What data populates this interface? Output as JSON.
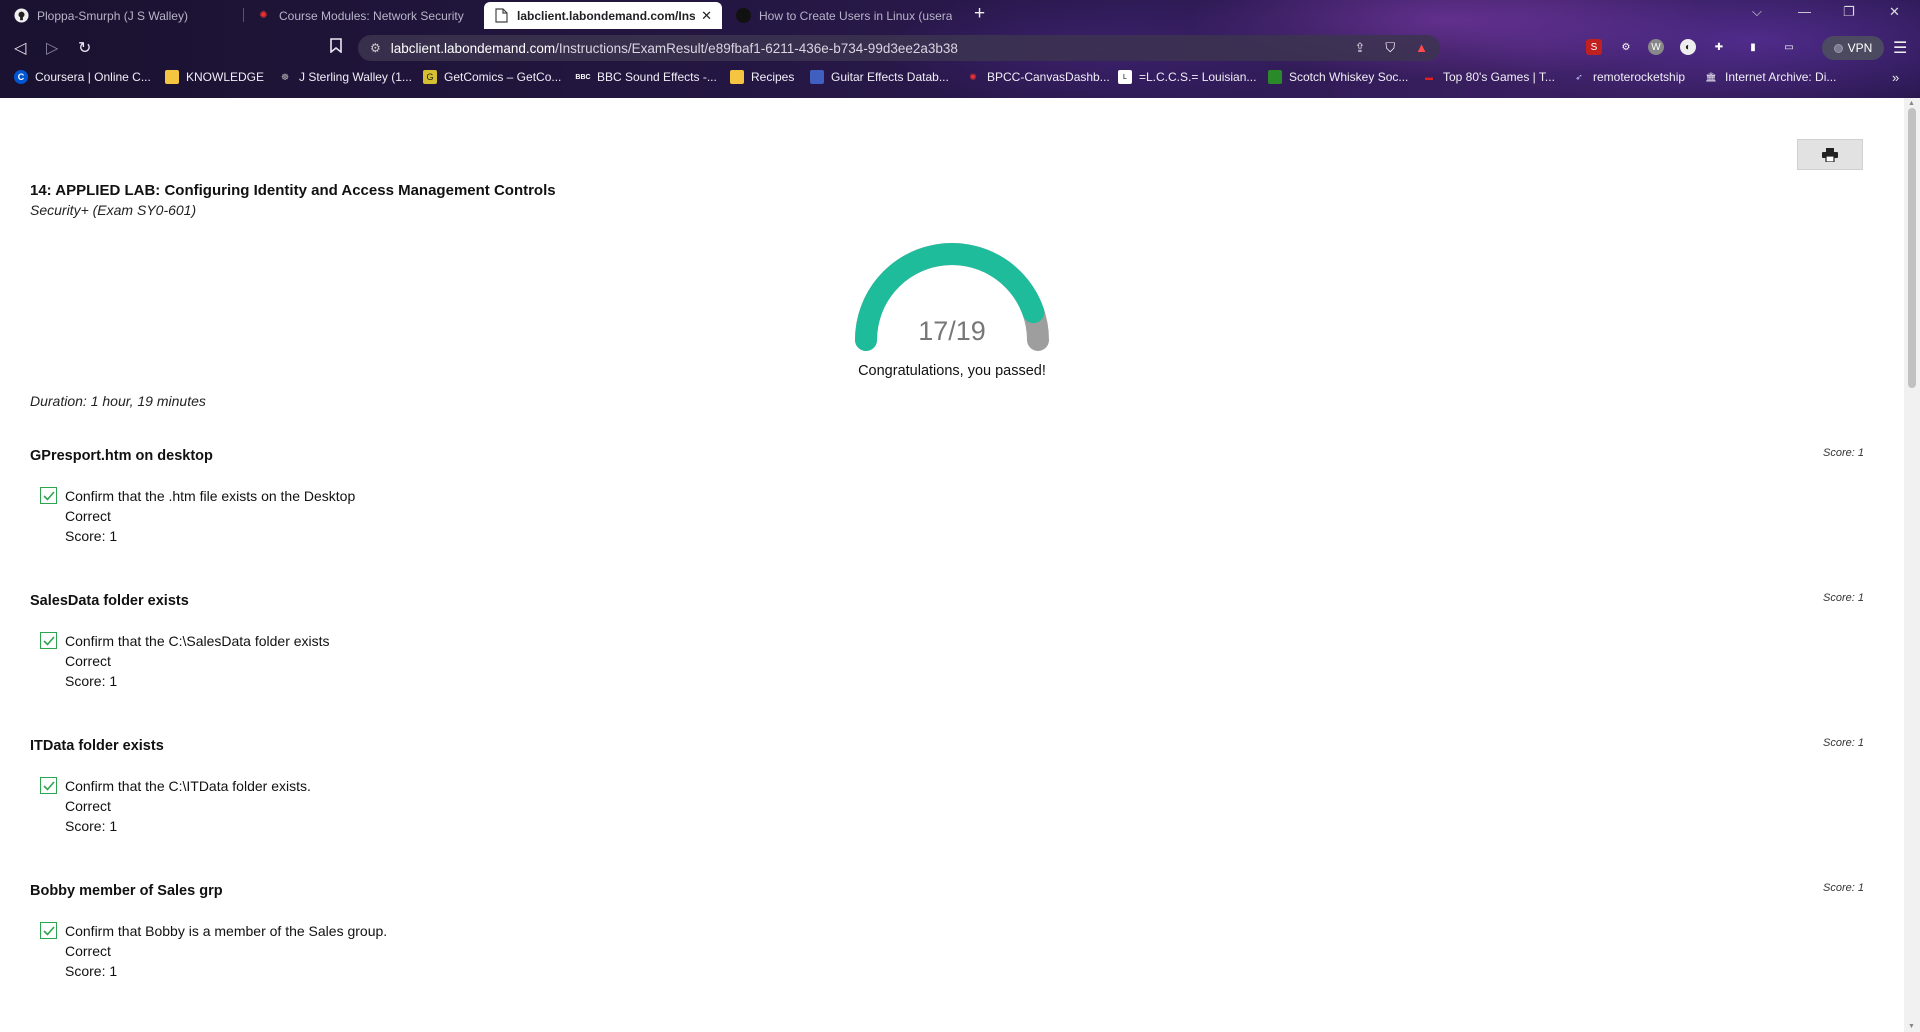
{
  "browser": {
    "tabs": [
      {
        "title": "Ploppa-Smurph (J S Walley)",
        "icon": "github-icon",
        "active": false
      },
      {
        "title": "Course Modules: Network Security De",
        "icon": "canvas-icon",
        "active": false
      },
      {
        "title": "labclient.labondemand.com/Inst",
        "icon": "document-icon",
        "active": true
      },
      {
        "title": "How to Create Users in Linux (useradd",
        "icon": "site-icon",
        "active": false
      }
    ],
    "url_host": "labclient.labondemand.com",
    "url_path": "/Instructions/ExamResult/e89fbaf1-6211-436e-b734-99d3ee2a3b38",
    "vpn_label": "VPN",
    "bookmarks": [
      {
        "label": "Coursera | Online C...",
        "icon": "coursera-icon",
        "color": "#0056d2"
      },
      {
        "label": "KNOWLEDGE",
        "icon": "folder-icon",
        "color": "#f5c542"
      },
      {
        "label": "J Sterling Walley (1...",
        "icon": "site-icon",
        "color": "#888888"
      },
      {
        "label": "GetComics – GetCo...",
        "icon": "getcomics-icon",
        "color": "#d4c030"
      },
      {
        "label": "BBC Sound Effects -...",
        "icon": "bbc-icon",
        "color": "#ffffff"
      },
      {
        "label": "Recipes",
        "icon": "folder-icon",
        "color": "#f5c542"
      },
      {
        "label": "Guitar Effects Datab...",
        "icon": "guitar-icon",
        "color": "#4060c0"
      },
      {
        "label": "BPCC-CanvasDashb...",
        "icon": "canvas-icon",
        "color": "#e03030"
      },
      {
        "label": "=L.C.C.S.= Louisian...",
        "icon": "site-icon",
        "color": "#ffffff"
      },
      {
        "label": "Scotch Whiskey Soc...",
        "icon": "whiskey-icon",
        "color": "#2a8a2a"
      },
      {
        "label": "Top 80's Games | T...",
        "icon": "games-icon",
        "color": "#e02020"
      },
      {
        "label": "remoterocketship",
        "icon": "rocket-icon",
        "color": "#c0c0ff"
      },
      {
        "label": "Internet Archive: Di...",
        "icon": "archive-icon",
        "color": "#ffffff"
      }
    ]
  },
  "lab": {
    "title": "14: APPLIED LAB: Configuring Identity and Access Management Controls",
    "subtitle": "Security+ (Exam SY0-601)",
    "score_text": "17/19",
    "score_fraction": 0.8947,
    "pass_message": "Congratulations, you passed!",
    "duration": "Duration: 1 hour, 19 minutes",
    "colors": {
      "gauge_fill": "#1fbc9c",
      "gauge_empty": "#9e9e9e",
      "check_green": "#2ea44f"
    }
  },
  "sections": [
    {
      "title": "GPresport.htm on desktop",
      "score": "Score: 1",
      "check_text": "Confirm that the .htm file exists on the Desktop",
      "result": "Correct",
      "check_score": "Score: 1"
    },
    {
      "title": "SalesData folder exists",
      "score": "Score: 1",
      "check_text": "Confirm that the C:\\SalesData folder exists",
      "result": "Correct",
      "check_score": "Score: 1"
    },
    {
      "title": "ITData folder exists",
      "score": "Score: 1",
      "check_text": "Confirm that the C:\\ITData folder exists.",
      "result": "Correct",
      "check_score": "Score: 1"
    },
    {
      "title": "Bobby member of Sales grp",
      "score": "Score: 1",
      "check_text": "Confirm that Bobby is a member of the Sales group.",
      "result": "Correct",
      "check_score": "Score: 1"
    }
  ]
}
